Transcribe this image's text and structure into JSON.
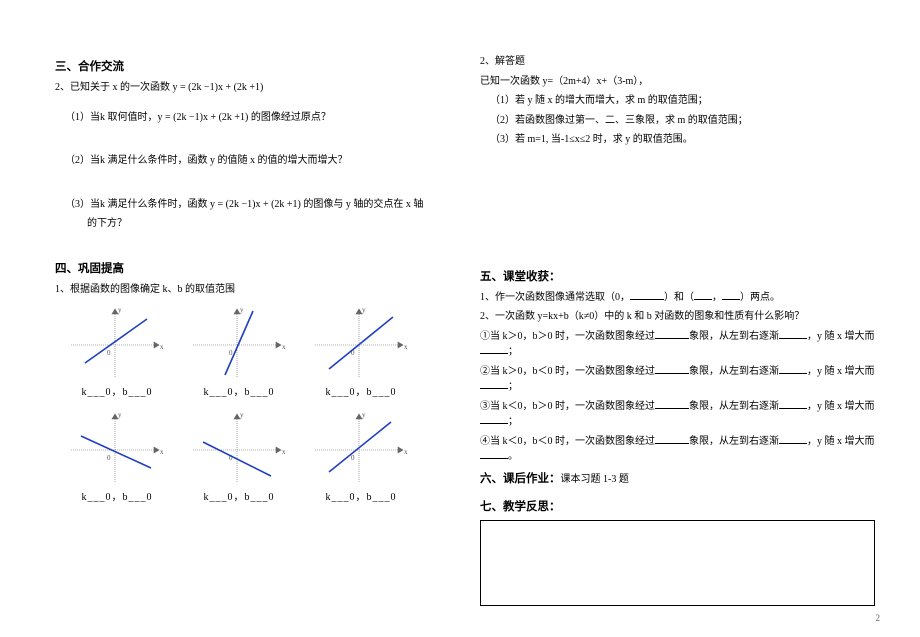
{
  "left": {
    "sec3_title": "三、合作交流",
    "q2_intro": "2、已知关于 x 的一次函数 y = (2k −1)x + (2k +1)",
    "q2_1": "（1）当k 取何值时，y = (2k −1)x + (2k +1) 的图像经过原点？",
    "q2_2": "（2）当k 满足什么条件时，函数 y 的值随 x 的值的增大而增大？",
    "q2_3a": "（3）当k 满足什么条件时，函数 y = (2k −1)x + (2k +1) 的图像与 y 轴的交点在 x 轴",
    "q2_3b": "的下方？",
    "sec4_title": "四、巩固提高",
    "sec4_q1": "1、根据函数的图像确定 k、b 的取值范围",
    "cap": "k___0，b___0",
    "chart_data": [
      {
        "type": "line",
        "slope": "+",
        "intercept": "+",
        "xlabel": "x",
        "ylabel": "y"
      },
      {
        "type": "line",
        "slope": "+",
        "intercept": "-",
        "xlabel": "x",
        "ylabel": "y"
      },
      {
        "type": "line",
        "slope": "+",
        "intercept": "0",
        "xlabel": "x",
        "ylabel": "y"
      },
      {
        "type": "line",
        "slope": "-",
        "intercept": "+",
        "xlabel": "x",
        "ylabel": "y"
      },
      {
        "type": "line",
        "slope": "-",
        "intercept": "-",
        "xlabel": "x",
        "ylabel": "y"
      },
      {
        "type": "line",
        "slope": "+",
        "intercept": "+",
        "xlabel": "x",
        "ylabel": "y"
      }
    ]
  },
  "right": {
    "q2_title": "2、解答题",
    "q2_intro": "已知一次函数 y=（2m+4）x+（3-m），",
    "q2_1": "（1）若 y 随 x 的增大而增大，求 m 的取值范围；",
    "q2_2": "（2）若函数图像过第一、二、三象限，求 m 的取值范围；",
    "q2_3": "（3）若 m=1, 当-1≤x≤2 时，求 y 的取值范围。",
    "sec5_title": "五、课堂收获：",
    "s5_l1a": "1、作一次函数图像通常选取（0，",
    "s5_l1b": "）和（",
    "s5_l1c": "，",
    "s5_l1d": "）两点。",
    "s5_l2": "2、一次函数 y=kx+b（k≠0）中的 k 和 b 对函数的图象和性质有什么影响？",
    "s5_c1a": "①当 k＞0，b＞0 时，一次函数图象经过",
    "s5_c1b": "象限，从左到右逐渐",
    "s5_c1c": "，y 随 x 增大而",
    "s5_c1d": "；",
    "s5_c2a": "②当 k＞0，b＜0 时，一次函数图象经过",
    "s5_c2b": "象限，从左到右逐渐",
    "s5_c2c": "，y 随 x 增大而",
    "s5_c2d": "；",
    "s5_c3a": "③当 k＜0，b＞0 时，一次函数图象经过",
    "s5_c3b": "象限，从左到右逐渐",
    "s5_c3c": "，y 随 x 增大而",
    "s5_c3d": "；",
    "s5_c4a": "④当 k＜0，b＜0 时，一次函数图象经过",
    "s5_c4b": "象限，从左到右逐渐",
    "s5_c4c": "，y 随 x 增大而",
    "s5_c4d": "。",
    "sec6_title": "六、课后作业：",
    "sec6_body": "课本习题 1-3 题",
    "sec7_title": "七、教学反思："
  },
  "page_number": "2"
}
